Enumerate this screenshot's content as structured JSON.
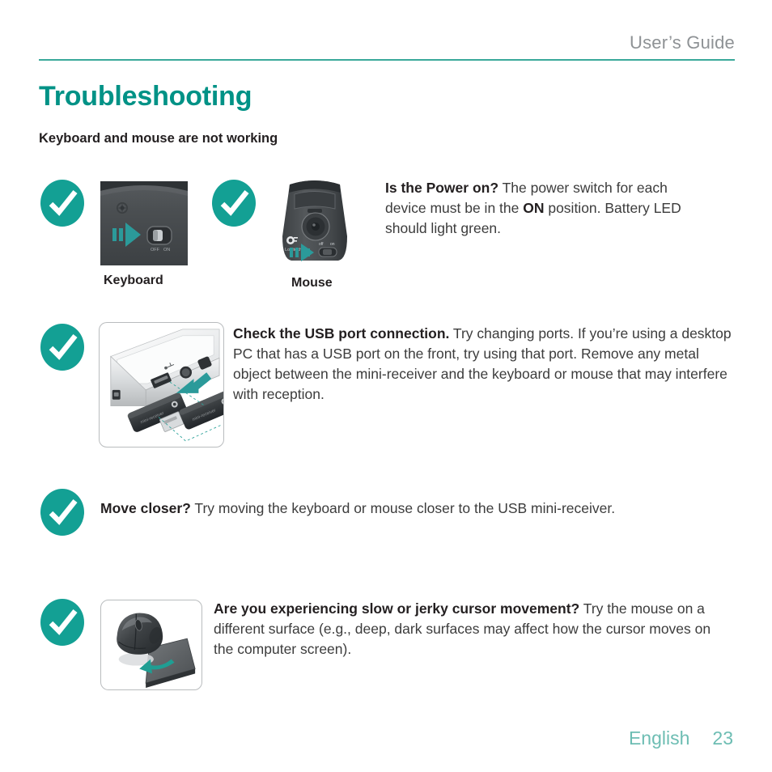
{
  "header": {
    "title": "User’s Guide",
    "rule_color": "#3aa99a"
  },
  "page_title": "Troubleshooting",
  "subtitle": "Keyboard and mouse are not working",
  "colors": {
    "teal": "#009286",
    "check_fill": "#13a094",
    "header_gray": "#8e9295",
    "footer_teal": "#6dbdb3",
    "body_text": "#3c3c3c"
  },
  "sections": [
    {
      "id": "power-on",
      "check_count": 2,
      "figures": [
        {
          "name": "keyboard-power-switch-figure",
          "caption": "Keyboard",
          "switch_off_label": "OFF",
          "switch_on_label": "ON"
        },
        {
          "name": "mouse-power-switch-figure",
          "caption": "Mouse",
          "brand": "Logitech",
          "switch_off_label": "off",
          "switch_on_label": "on"
        }
      ],
      "lead": "Is the Power on?",
      "body_1": " The power switch for each device must be in the ",
      "emphasis": "ON",
      "body_2": " position. Battery LED should light green."
    },
    {
      "id": "usb-port",
      "check_count": 1,
      "figures": [
        {
          "name": "usb-receiver-plug-figure",
          "caption": ""
        }
      ],
      "lead": "Check the USB port connection.",
      "body_1": " Try changing ports. If you’re using a desktop PC that has a USB port on the front, try using that port. Remove any metal object between the mini-receiver and the keyboard or mouse that may interfere with reception."
    },
    {
      "id": "move-closer",
      "check_count": 1,
      "figures": [],
      "lead": "Move closer?",
      "body_1": " Try moving the keyboard or mouse closer to the USB mini-receiver."
    },
    {
      "id": "cursor-movement",
      "check_count": 1,
      "figures": [
        {
          "name": "mouse-on-surface-figure",
          "caption": ""
        }
      ],
      "lead": "Are you experiencing slow or jerky cursor movement?",
      "body_1": " Try the mouse on a different surface (e.g., deep, dark surfaces may affect how the cursor moves on the computer screen)."
    }
  ],
  "footer": {
    "language": "English",
    "page_number": "23"
  }
}
